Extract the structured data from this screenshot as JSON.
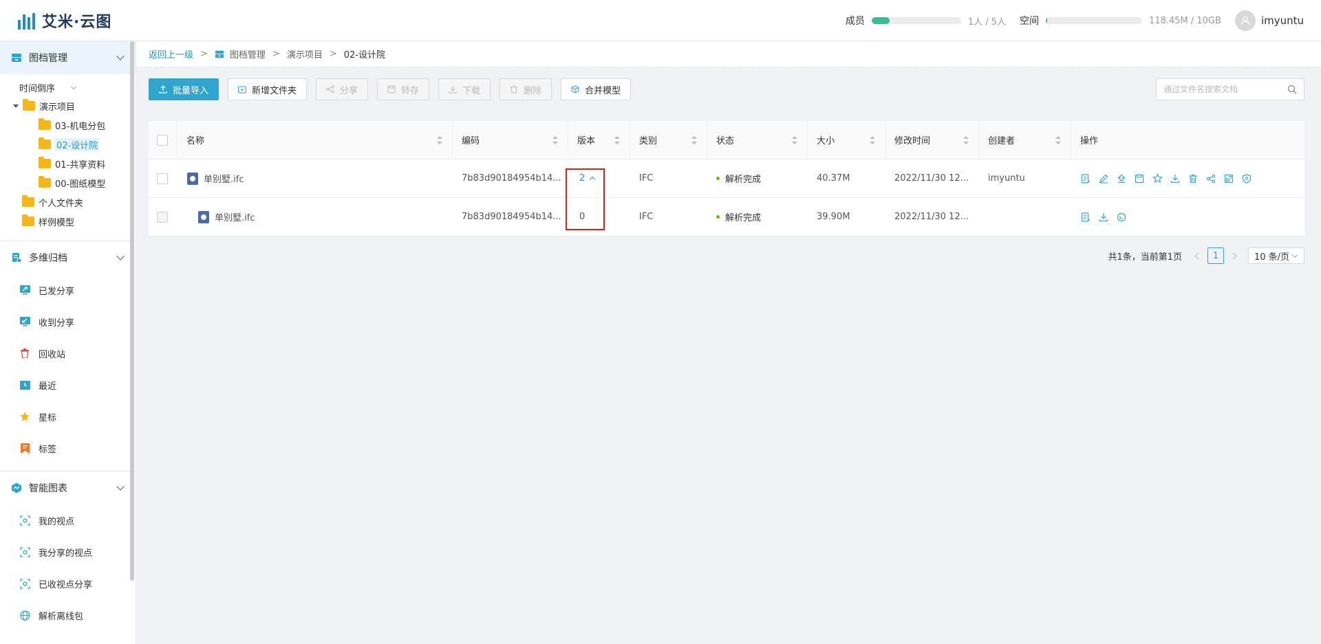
{
  "app": {
    "logo_text": "艾米·云图"
  },
  "header": {
    "members_label": "成员",
    "members_value": "1人 / 5人",
    "members_fraction": 0.2,
    "space_label": "空间",
    "space_value": "118.45M / 10GB",
    "space_fraction": 0.012,
    "username": "imyuntu"
  },
  "sidebar": {
    "archive": {
      "label": "图档管理",
      "sort_label": "时间倒序",
      "tree": {
        "root": "演示项目",
        "children": [
          "03-机电分包",
          "02-设计院",
          "01-共享资料",
          "00-图纸模型"
        ],
        "selected": "02-设计院",
        "others": [
          "个人文件夹",
          "样例模型"
        ]
      }
    },
    "multi": {
      "label": "多维归档",
      "items": [
        "已发分享",
        "收到分享",
        "回收站",
        "最近",
        "星标",
        "标签"
      ]
    },
    "charts": {
      "label": "智能图表",
      "items": [
        "我的视点",
        "我分享的视点",
        "已收视点分享",
        "解析离线包"
      ]
    }
  },
  "breadcrumb": {
    "back": "返回上一级",
    "sep": ">",
    "items": [
      "图档管理",
      "演示项目",
      "02-设计院"
    ]
  },
  "toolbar": {
    "import": "批量导入",
    "new_folder": "新增文件夹",
    "share": "分享",
    "transfer": "转存",
    "download": "下载",
    "delete": "删除",
    "merge": "合并模型",
    "search_placeholder": "通过文件名搜索文档"
  },
  "table": {
    "columns": [
      "名称",
      "编码",
      "版本",
      "类别",
      "状态",
      "大小",
      "修改时间",
      "创建者",
      "操作"
    ],
    "rows": [
      {
        "name": "单别墅.ifc",
        "code": "7b83d90184954b14...",
        "version": "2",
        "type": "IFC",
        "status": "解析完成",
        "size": "40.37M",
        "time": "2022/11/30 12...",
        "creator": "imyuntu"
      },
      {
        "name": "单别墅.ifc",
        "code": "7b83d90184954b14...",
        "version": "0",
        "type": "IFC",
        "status": "解析完成",
        "size": "39.90M",
        "time": "2022/11/30 12...",
        "creator": ""
      }
    ]
  },
  "pagination": {
    "summary": "共1条，当前第1页",
    "current": "1",
    "page_size": "10 条/页"
  },
  "colors": {
    "accent": "#2ea6cd",
    "member_bar": "#3cba92",
    "highlight": "#e01b1b"
  }
}
